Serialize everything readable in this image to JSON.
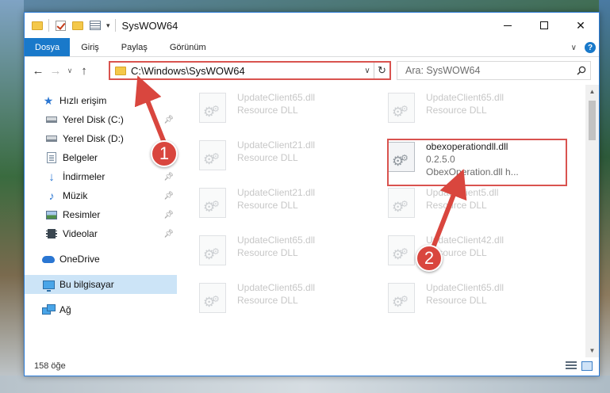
{
  "window": {
    "title": "SysWOW64",
    "controls": {
      "minimize": "",
      "maximize": "",
      "close": "✕"
    }
  },
  "ribbon": {
    "tabs": [
      {
        "label": "Dosya"
      },
      {
        "label": "Giriş"
      },
      {
        "label": "Paylaş"
      },
      {
        "label": "Görünüm"
      }
    ],
    "help": "?",
    "expand": "∨"
  },
  "address_bar": {
    "path": "C:\\Windows\\SysWOW64",
    "dropdown": "∨",
    "refresh": "↻"
  },
  "search": {
    "placeholder": "Ara: SysWOW64"
  },
  "navigation": {
    "back": "←",
    "forward": "→",
    "recent": "∨",
    "up": "↑"
  },
  "sidebar": {
    "items": [
      {
        "label": "Hızlı erişim"
      },
      {
        "label": "Yerel Disk (C:)"
      },
      {
        "label": "Yerel Disk (D:)"
      },
      {
        "label": "Belgeler"
      },
      {
        "label": "İndirmeler"
      },
      {
        "label": "Müzik"
      },
      {
        "label": "Resimler"
      },
      {
        "label": "Videolar"
      },
      {
        "label": "OneDrive"
      },
      {
        "label": "Bu bilgisayar"
      },
      {
        "label": "Ağ"
      }
    ]
  },
  "files": [
    {
      "name": "UpdateClient65.dll",
      "desc": "Resource DLL"
    },
    {
      "name": "UpdateClient65.dll",
      "desc": "Resource DLL"
    },
    {
      "name": "UpdateClient21.dll",
      "desc": "Resource DLL"
    },
    {
      "name": "obexoperationdll.dll",
      "version": "0.2.5.0",
      "desc": "ObexOperation.dll h..."
    },
    {
      "name": "UpdateClient21.dll",
      "desc": "Resource DLL"
    },
    {
      "name": "UpdateClient5.dll",
      "desc": "Resource DLL"
    },
    {
      "name": "UpdateClient65.dll",
      "desc": "Resource DLL"
    },
    {
      "name": "UpdateClient42.dll",
      "desc": "Resource DLL"
    },
    {
      "name": "UpdateClient65.dll",
      "desc": "Resource DLL"
    },
    {
      "name": "UpdateClient65.dll",
      "desc": "Resource DLL"
    }
  ],
  "status": {
    "item_count": "158 öğe"
  },
  "callouts": {
    "one": "1",
    "two": "2"
  },
  "colors": {
    "accent": "#1979ca",
    "annotation": "#d9534f"
  }
}
